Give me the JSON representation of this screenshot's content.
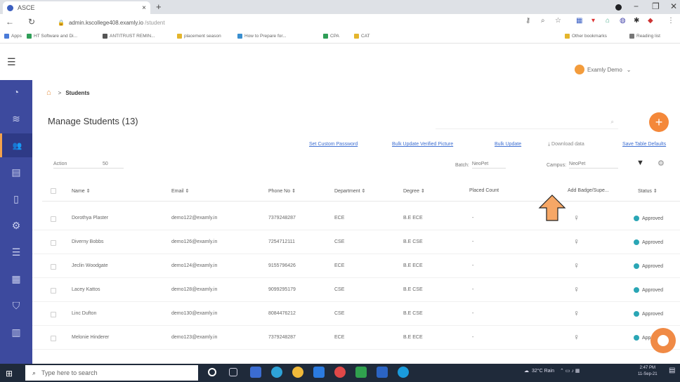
{
  "browser": {
    "tab_title": "ASCE",
    "tab_close": "×",
    "new_tab": "+",
    "url_host": "admin.kscollege408.examly.io",
    "url_path": "/student",
    "bookmarks": [
      {
        "label": "Apps",
        "color": "#4a7bd8"
      },
      {
        "label": "HT Software and Di...",
        "color": "#2f9e57"
      },
      {
        "label": "ANTITRUST REMIN...",
        "color": "#555555"
      },
      {
        "label": "placement season",
        "color": "#e4b52c"
      },
      {
        "label": "How to Prepare for...",
        "color": "#3a8fd0"
      },
      {
        "label": "CPA",
        "color": "#2f9e57"
      },
      {
        "label": "CAT",
        "color": "#e4b52c"
      }
    ],
    "other_bookmarks": "Other bookmarks",
    "reading_list": "Reading list"
  },
  "header": {
    "user_name": "Examly Demo",
    "accent": "#f3a24b"
  },
  "sidebar": {
    "bg": "#3d4a9e",
    "items": [
      {
        "icon": "dashboard-icon",
        "glyph": "◔"
      },
      {
        "icon": "database-icon",
        "glyph": "≋"
      },
      {
        "icon": "users-icon",
        "glyph": "👥"
      },
      {
        "icon": "document-icon",
        "glyph": "▤"
      },
      {
        "icon": "file-icon",
        "glyph": "▯"
      },
      {
        "icon": "settings-icon",
        "glyph": "⚙"
      },
      {
        "icon": "list-icon",
        "glyph": "☰"
      },
      {
        "icon": "building-icon",
        "glyph": "▦"
      },
      {
        "icon": "shield-icon",
        "glyph": "⛉"
      },
      {
        "icon": "report-icon",
        "glyph": "▥"
      }
    ]
  },
  "breadcrumb": {
    "separator": ">",
    "current": "Students"
  },
  "page": {
    "title": "Manage Students (13)"
  },
  "toolbar": {
    "set_custom_password": "Set Custom Password",
    "bulk_update_verified_picture": "Bulk Update Verified Picture",
    "bulk_update": "Bulk Update",
    "download_data": "Download data",
    "save_table_defaults": "Save Table Defaults"
  },
  "filters": {
    "action_label": "Action",
    "page_size": "50",
    "batch_label": "Batch:",
    "batch_value": "NeoPet",
    "campus_label": "Campus:",
    "campus_value": "NeoPet"
  },
  "table": {
    "columns": [
      "Name ⇕",
      "Email ⇕",
      "Phone No ⇕",
      "Department ⇕",
      "Degree ⇕",
      "Placed Count",
      "Add Badge/Supe...",
      "Status ⇕"
    ],
    "rows": [
      {
        "name": "Dorothya Plaster",
        "email": "demo122@examly.in",
        "phone": "7379248287",
        "department": "ECE",
        "degree": "B.E ECE",
        "placed": "-",
        "status": "Approved"
      },
      {
        "name": "Diverny Bobbs",
        "email": "demo126@examly.in",
        "phone": "7254712111",
        "department": "CSE",
        "degree": "B.E CSE",
        "placed": "-",
        "status": "Approved"
      },
      {
        "name": "Jeclin Woodgate",
        "email": "demo124@examly.in",
        "phone": "9155796426",
        "department": "ECE",
        "degree": "B.E ECE",
        "placed": "-",
        "status": "Approved"
      },
      {
        "name": "Lacey Kattos",
        "email": "demo128@examly.in",
        "phone": "9099295179",
        "department": "CSE",
        "degree": "B.E CSE",
        "placed": "-",
        "status": "Approved"
      },
      {
        "name": "Linc Dufton",
        "email": "demo130@examly.in",
        "phone": "8084476212",
        "department": "CSE",
        "degree": "B.E CSE",
        "placed": "-",
        "status": "Approved"
      },
      {
        "name": "Melonie Hinderer",
        "email": "demo123@examly.in",
        "phone": "7379248287",
        "department": "ECE",
        "degree": "B.E ECE",
        "placed": "-",
        "status": "Approved"
      }
    ],
    "status_color": "#2aa6b5"
  },
  "taskbar": {
    "search_placeholder": "Type here to search",
    "weather": "32°C Rain",
    "time": "2:47 PM",
    "date": "11-Sep-21",
    "app_colors": [
      "#3b6cd1",
      "#2ea3d8",
      "#f0b93a",
      "#2b7be0",
      "#e04848",
      "#30a14e",
      "#2b64c4",
      "#1a9bdc"
    ]
  }
}
